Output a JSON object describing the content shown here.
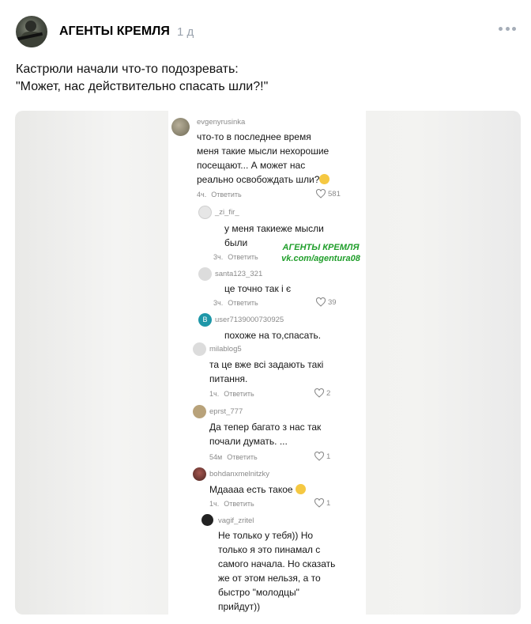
{
  "post": {
    "author": "АГЕНТЫ КРЕМЛЯ",
    "time": "1 д",
    "text_line1": "Кастрюли начали что-то подозревать:",
    "text_line2": "\"Может, нас действительно спасать шли?!\""
  },
  "watermark": {
    "line1": "АГЕНТЫ КРЕМЛЯ",
    "line2": "vk.com/agentura08"
  },
  "comments": [
    {
      "user": "evgenyrusinka",
      "text": [
        "что-то в последнее время",
        "меня такие мысли нехорошие",
        "посещают... А может нас",
        "реально освобождать шли?"
      ],
      "time": "4ч.",
      "reply": "Ответить",
      "likes": "581"
    },
    {
      "user": "_zi_fir_",
      "text": [
        "у меня такиеже мысли",
        "были"
      ],
      "time": "3ч.",
      "reply": "Ответить",
      "likes": ""
    },
    {
      "user": "santa123_321",
      "text": [
        "це точно так і є"
      ],
      "time": "3ч.",
      "reply": "Ответить",
      "likes": "39"
    },
    {
      "user": "user7139000730925",
      "text": [
        "похоже на то,спасать."
      ],
      "time": "",
      "reply": "",
      "likes": ""
    },
    {
      "user": "milablog5",
      "text": [
        "та це вже всі задають такі",
        "питання."
      ],
      "time": "1ч.",
      "reply": "Ответить",
      "likes": "2"
    },
    {
      "user": "eprst_777",
      "text": [
        "Да тепер багато з нас так",
        "почали думать. ..."
      ],
      "time": "54м",
      "reply": "Ответить",
      "likes": "1"
    },
    {
      "user": "bohdanxmelnitzky",
      "text": [
        "Мдаааа есть такое"
      ],
      "time": "1ч.",
      "reply": "Ответить",
      "likes": "1"
    },
    {
      "user": "vagif_zritel",
      "text": [
        "Не только у тебя)) Но",
        "только я это пинамал с",
        "самого начала. Но сказать",
        "же от этом нельзя, а то",
        "быстро \"молодцы\"",
        "прийдут))"
      ],
      "time": "",
      "reply": "",
      "likes": ""
    }
  ],
  "colors": {
    "accent_time": "#99a2ad",
    "watermark": "#1f9e2a"
  }
}
